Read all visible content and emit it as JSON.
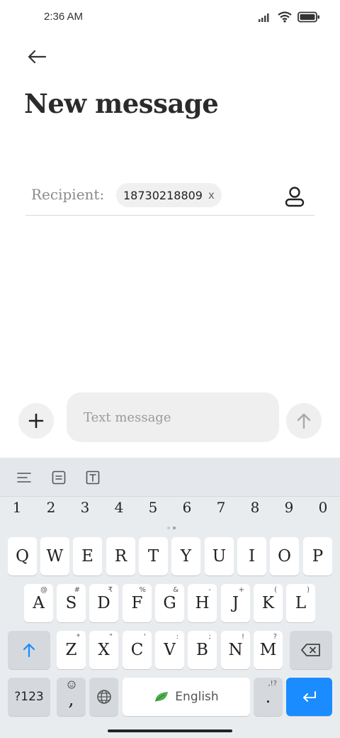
{
  "status": {
    "time": "2:36 AM"
  },
  "header": {
    "title": "New message"
  },
  "recipient": {
    "label": "Recipient:",
    "chip_number": "18730218809",
    "chip_remove": "x"
  },
  "compose": {
    "placeholder": "Text message"
  },
  "keyboard": {
    "numbers": [
      "1",
      "2",
      "3",
      "4",
      "5",
      "6",
      "7",
      "8",
      "9",
      "0"
    ],
    "row1": [
      "Q",
      "W",
      "E",
      "R",
      "T",
      "Y",
      "U",
      "I",
      "O",
      "P"
    ],
    "row2": [
      "A",
      "S",
      "D",
      "F",
      "G",
      "H",
      "J",
      "K",
      "L"
    ],
    "row2_hints": [
      "@",
      "#",
      "₹",
      "%",
      "&",
      "-",
      "+",
      "(",
      ")"
    ],
    "row3": [
      "Z",
      "X",
      "C",
      "V",
      "B",
      "N",
      "M"
    ],
    "row3_hints": [
      "*",
      "\"",
      "'",
      ":",
      ";",
      "!",
      "?"
    ],
    "symbols_key": "?123",
    "comma_key": ",",
    "space_label": "English",
    "period_key": ".",
    "period_hint": ",!?"
  },
  "colors": {
    "enter_key": "#1a8cff",
    "shift_arrow": "#1a8cff",
    "leaf": "#4caf50"
  }
}
